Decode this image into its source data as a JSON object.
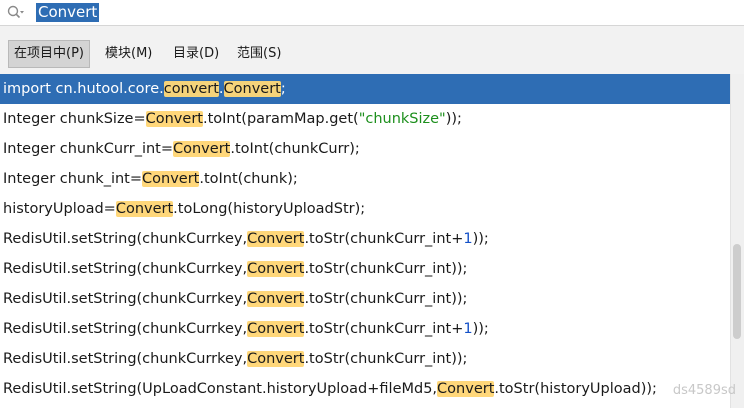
{
  "search": {
    "query": "Convert"
  },
  "scopes": [
    {
      "label": "在项目中(P)",
      "active": true
    },
    {
      "label": "模块(M)",
      "active": false
    },
    {
      "label": "目录(D)",
      "active": false
    },
    {
      "label": "范围(S)",
      "active": false
    }
  ],
  "results": [
    {
      "selected": true,
      "segments": [
        [
          "t",
          "import cn.hutool.core."
        ],
        [
          "h",
          "convert"
        ],
        [
          "t",
          "."
        ],
        [
          "h",
          "Convert"
        ],
        [
          "t",
          ";"
        ]
      ]
    },
    {
      "selected": false,
      "segments": [
        [
          "t",
          "Integer chunkSize="
        ],
        [
          "h",
          "Convert"
        ],
        [
          "t",
          ".toInt(paramMap.get("
        ],
        [
          "s",
          "\"chunkSize\""
        ],
        [
          "t",
          "));"
        ]
      ]
    },
    {
      "selected": false,
      "segments": [
        [
          "t",
          "Integer chunkCurr_int="
        ],
        [
          "h",
          "Convert"
        ],
        [
          "t",
          ".toInt(chunkCurr);"
        ]
      ]
    },
    {
      "selected": false,
      "segments": [
        [
          "t",
          "Integer chunk_int="
        ],
        [
          "h",
          "Convert"
        ],
        [
          "t",
          ".toInt(chunk);"
        ]
      ]
    },
    {
      "selected": false,
      "segments": [
        [
          "t",
          "historyUpload="
        ],
        [
          "h",
          "Convert"
        ],
        [
          "t",
          ".toLong(historyUploadStr);"
        ]
      ]
    },
    {
      "selected": false,
      "segments": [
        [
          "t",
          "RedisUtil.setString(chunkCurrkey,"
        ],
        [
          "h",
          "Convert"
        ],
        [
          "t",
          ".toStr(chunkCurr_int+"
        ],
        [
          "n",
          "1"
        ],
        [
          "t",
          "));"
        ]
      ]
    },
    {
      "selected": false,
      "segments": [
        [
          "t",
          "RedisUtil.setString(chunkCurrkey,"
        ],
        [
          "h",
          "Convert"
        ],
        [
          "t",
          ".toStr(chunkCurr_int));"
        ]
      ]
    },
    {
      "selected": false,
      "segments": [
        [
          "t",
          "RedisUtil.setString(chunkCurrkey,"
        ],
        [
          "h",
          "Convert"
        ],
        [
          "t",
          ".toStr(chunkCurr_int));"
        ]
      ]
    },
    {
      "selected": false,
      "segments": [
        [
          "t",
          "RedisUtil.setString(chunkCurrkey,"
        ],
        [
          "h",
          "Convert"
        ],
        [
          "t",
          ".toStr(chunkCurr_int+"
        ],
        [
          "n",
          "1"
        ],
        [
          "t",
          "));"
        ]
      ]
    },
    {
      "selected": false,
      "segments": [
        [
          "t",
          "RedisUtil.setString(chunkCurrkey,"
        ],
        [
          "h",
          "Convert"
        ],
        [
          "t",
          ".toStr(chunkCurr_int));"
        ]
      ]
    },
    {
      "selected": false,
      "segments": [
        [
          "t",
          "RedisUtil.setString(UpLoadConstant.historyUpload+fileMd5,"
        ],
        [
          "h",
          "Convert"
        ],
        [
          "t",
          ".toStr(historyUpload));"
        ]
      ]
    }
  ],
  "watermark": "ds4589sd",
  "colors": {
    "selection": "#2e6db4",
    "highlight": "#ffd77a",
    "string": "#1d8f1d",
    "number": "#1451c8"
  }
}
